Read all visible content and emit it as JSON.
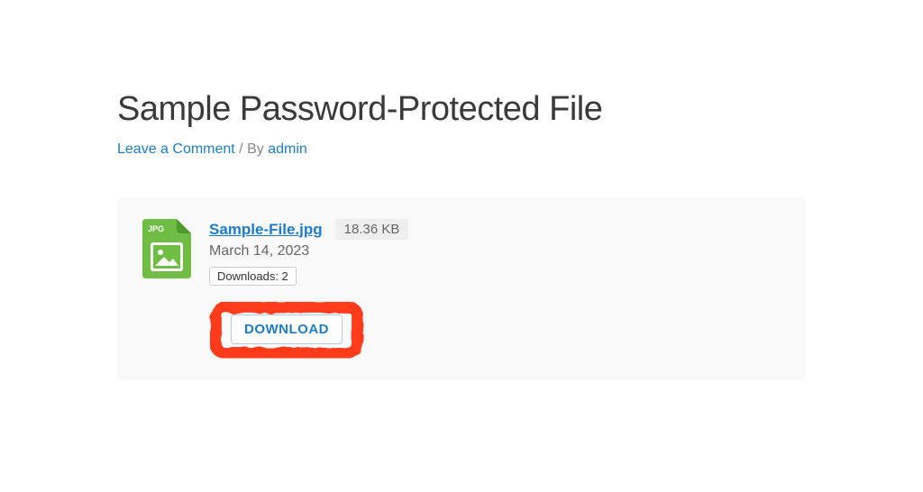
{
  "page": {
    "title": "Sample Password-Protected File"
  },
  "meta": {
    "comment_link": "Leave a Comment",
    "separator": " / By ",
    "author": "admin"
  },
  "file": {
    "name": "Sample-File.jpg",
    "size": "18.36 KB",
    "date": "March 14, 2023",
    "downloads_label": "Downloads: 2",
    "type_label": "JPG"
  },
  "actions": {
    "download": "DOWNLOAD"
  }
}
